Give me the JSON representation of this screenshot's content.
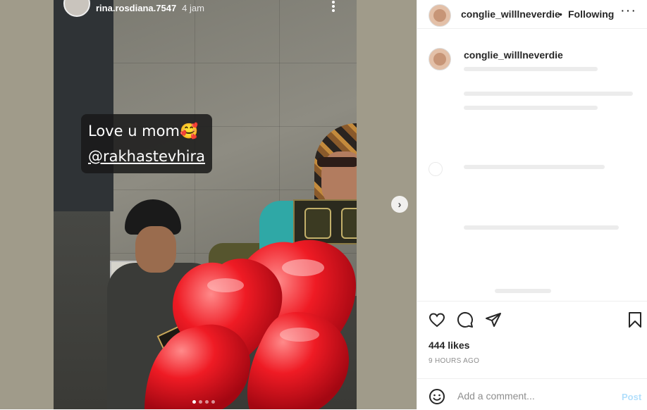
{
  "story": {
    "username": "rina.rosdiana.7547",
    "time": "4 jam",
    "caption_line1": "Love u mom🥰",
    "caption_line2": "@rakhastevhira",
    "more_icon": "more-vertical-icon",
    "dots_total": 4,
    "dots_active": 1
  },
  "carousel": {
    "next_icon": "chevron-right-icon",
    "next_symbol": "›"
  },
  "post": {
    "username": "conglie_willlneverdie",
    "separator": "•",
    "follow_state": "Following",
    "more_symbol": "···",
    "comment_username": "conglie_willlneverdie",
    "likes": "444 likes",
    "time": "9 HOURS AGO",
    "comment_placeholder": "Add a comment...",
    "post_label": "Post"
  },
  "colors": {
    "link_disabled": "#b2dffc",
    "text": "#262626",
    "muted": "#8e8e8e"
  }
}
